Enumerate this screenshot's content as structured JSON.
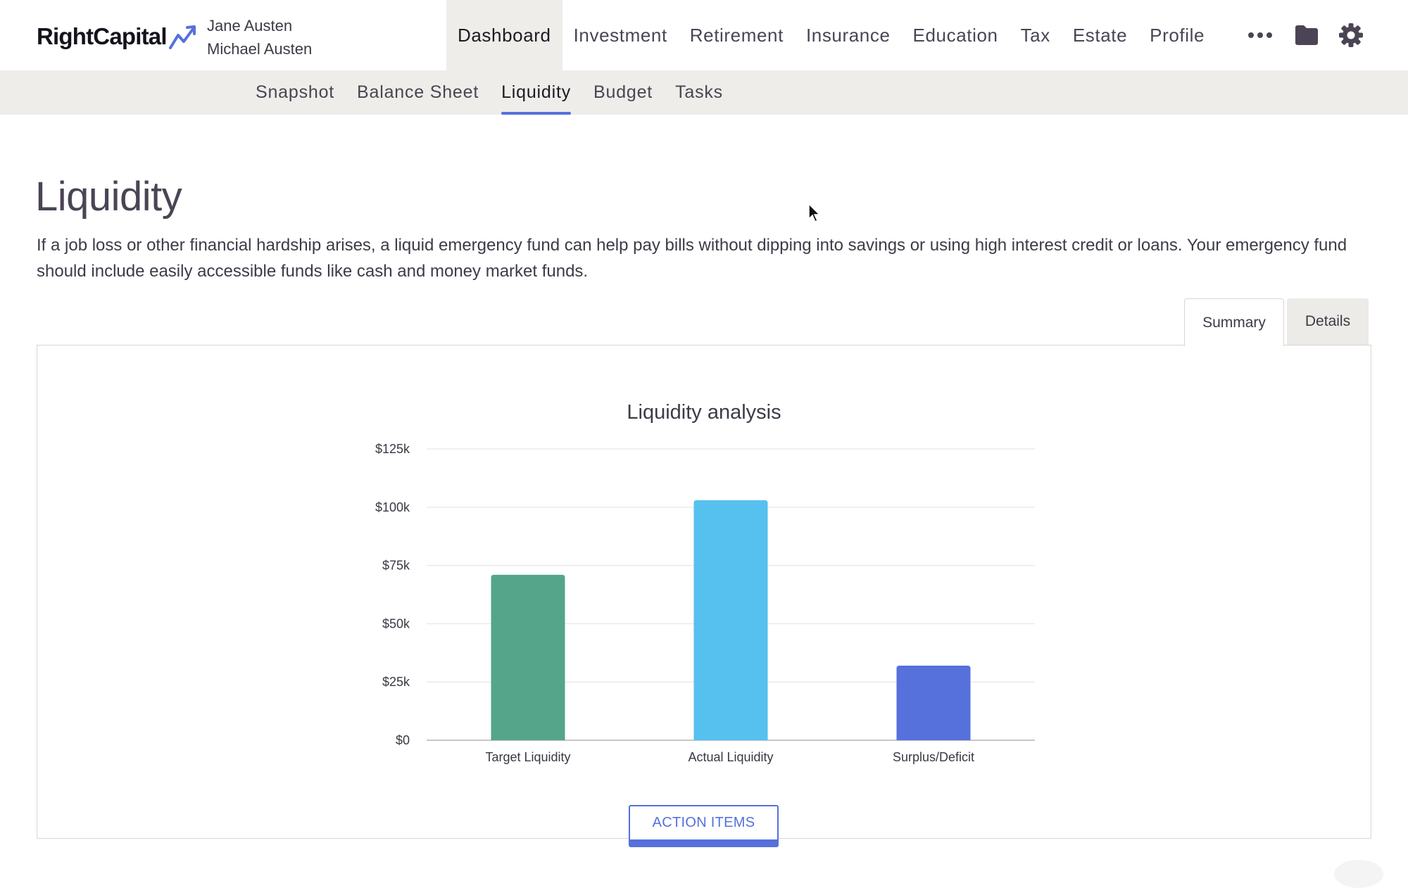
{
  "header": {
    "logo_text": "RightCapital",
    "clients": [
      "Jane Austen",
      "Michael Austen"
    ],
    "nav": [
      {
        "label": "Dashboard",
        "active": true
      },
      {
        "label": "Investment",
        "active": false
      },
      {
        "label": "Retirement",
        "active": false
      },
      {
        "label": "Insurance",
        "active": false
      },
      {
        "label": "Education",
        "active": false
      },
      {
        "label": "Tax",
        "active": false
      },
      {
        "label": "Estate",
        "active": false
      },
      {
        "label": "Profile",
        "active": false
      }
    ],
    "icons": [
      "more-icon",
      "folder-icon",
      "gear-icon"
    ]
  },
  "subnav": [
    {
      "label": "Snapshot",
      "active": false
    },
    {
      "label": "Balance Sheet",
      "active": false
    },
    {
      "label": "Liquidity",
      "active": true
    },
    {
      "label": "Budget",
      "active": false
    },
    {
      "label": "Tasks",
      "active": false
    }
  ],
  "page": {
    "title": "Liquidity",
    "description": "If a job loss or other financial hardship arises, a liquid emergency fund can help pay bills without dipping into savings or using high interest credit or loans. Your emergency fund should include easily accessible funds like cash and money market funds."
  },
  "tabs": [
    {
      "label": "Summary",
      "active": true
    },
    {
      "label": "Details",
      "active": false
    }
  ],
  "chart_data": {
    "type": "bar",
    "title": "Liquidity analysis",
    "categories": [
      "Target Liquidity",
      "Actual Liquidity",
      "Surplus/Deficit"
    ],
    "values": [
      71000,
      103000,
      32000
    ],
    "colors": [
      "#54a58a",
      "#56c0ef",
      "#5670dc"
    ],
    "ylim": [
      0,
      125000
    ],
    "yticks": [
      0,
      25000,
      50000,
      75000,
      100000,
      125000
    ],
    "ytick_labels": [
      "$0",
      "$25k",
      "$50k",
      "$75k",
      "$100k",
      "$125k"
    ],
    "grid": true,
    "legend": "none"
  },
  "action_button": {
    "label": "ACTION ITEMS"
  },
  "colors": {
    "accent": "#5670dc",
    "nav_bg": "#efede9",
    "text": "#4a4454"
  }
}
